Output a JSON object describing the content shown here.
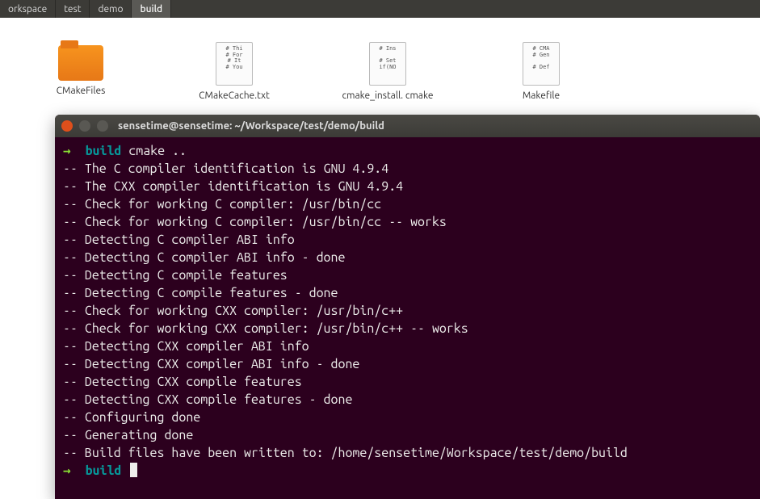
{
  "breadcrumb": [
    "orkspace",
    "test",
    "demo",
    "build"
  ],
  "breadcrumb_active_index": 3,
  "files": [
    {
      "name": "CMakeFiles",
      "kind": "folder",
      "preview": ""
    },
    {
      "name": "CMakeCache.txt",
      "kind": "text",
      "preview": "# Thi\n# For\n# It\n# You"
    },
    {
      "name": "cmake_install.\ncmake",
      "kind": "text",
      "preview": "# Ins\n\n# Set\nif(NO"
    },
    {
      "name": "Makefile",
      "kind": "text",
      "preview": "# CMA\n# Gen\n\n# Def"
    }
  ],
  "terminal": {
    "title": "sensetime@sensetime: ~/Workspace/test/demo/build",
    "prompt_dir": "build",
    "command": "cmake ..",
    "output": [
      "-- The C compiler identification is GNU 4.9.4",
      "-- The CXX compiler identification is GNU 4.9.4",
      "-- Check for working C compiler: /usr/bin/cc",
      "-- Check for working C compiler: /usr/bin/cc -- works",
      "-- Detecting C compiler ABI info",
      "-- Detecting C compiler ABI info - done",
      "-- Detecting C compile features",
      "-- Detecting C compile features - done",
      "-- Check for working CXX compiler: /usr/bin/c++",
      "-- Check for working CXX compiler: /usr/bin/c++ -- works",
      "-- Detecting CXX compiler ABI info",
      "-- Detecting CXX compiler ABI info - done",
      "-- Detecting CXX compile features",
      "-- Detecting CXX compile features - done",
      "-- Configuring done",
      "-- Generating done",
      "-- Build files have been written to: /home/sensetime/Workspace/test/demo/build"
    ]
  }
}
